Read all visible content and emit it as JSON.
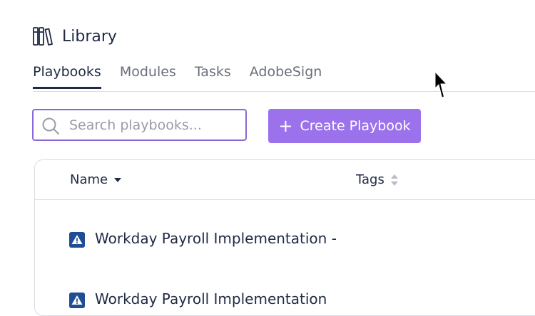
{
  "header": {
    "title": "Library",
    "icon": "books-icon"
  },
  "tabs": [
    {
      "label": "Playbooks",
      "active": true
    },
    {
      "label": "Modules",
      "active": false
    },
    {
      "label": "Tasks",
      "active": false
    },
    {
      "label": "AdobeSign",
      "active": false
    }
  ],
  "search": {
    "placeholder": "Search playbooks...",
    "value": ""
  },
  "create_button": {
    "label": "Create Playbook"
  },
  "table": {
    "columns": [
      {
        "label": "Name",
        "sort": "descending"
      },
      {
        "label": "Tags",
        "sort": "none"
      }
    ],
    "rows": [
      {
        "name": "Workday Payroll Implementation -",
        "icon": "warning-icon"
      },
      {
        "name": "Workday Payroll Implementation",
        "icon": "warning-icon"
      }
    ]
  },
  "colors": {
    "accent": "#9b72ec",
    "text": "#1f2a44",
    "warning_badge": "#1f4e96"
  }
}
